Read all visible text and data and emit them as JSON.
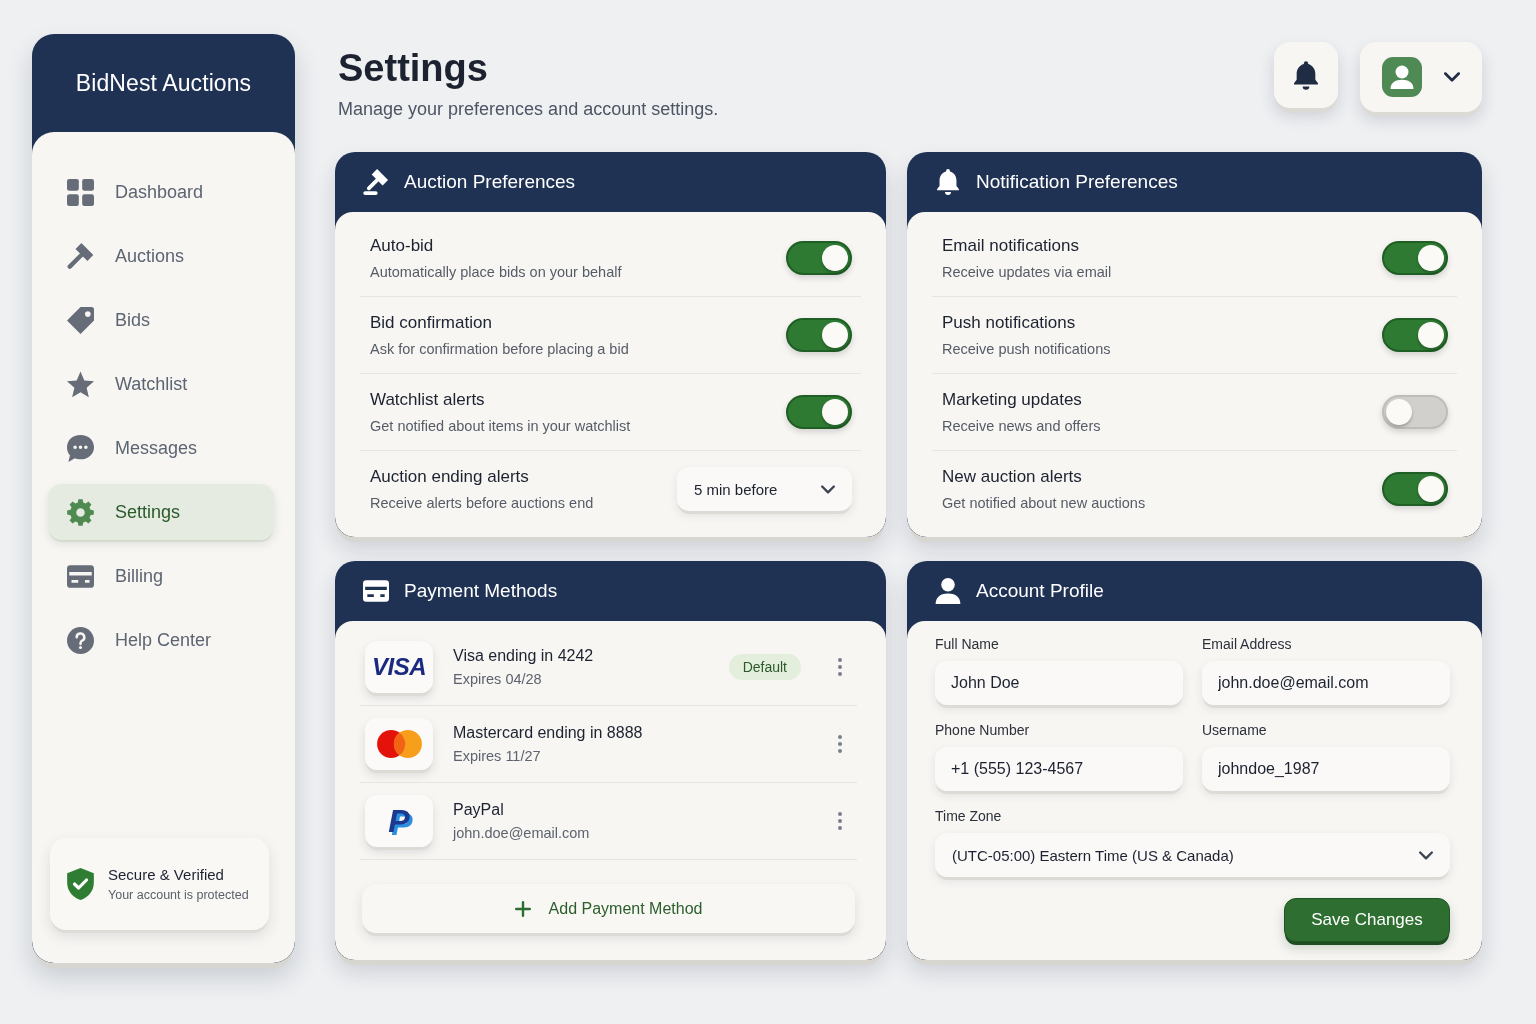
{
  "sidebar": {
    "brand": "BidNest Auctions",
    "items": [
      {
        "label": "Dashboard",
        "selected": false
      },
      {
        "label": "Auctions",
        "selected": false
      },
      {
        "label": "Bids",
        "selected": false
      },
      {
        "label": "Watchlist",
        "selected": false
      },
      {
        "label": "Messages",
        "selected": false
      },
      {
        "label": "Settings",
        "selected": true
      },
      {
        "label": "Billing",
        "selected": false
      },
      {
        "label": "Help Center",
        "selected": false
      }
    ],
    "security": {
      "title": "Secure & Verified",
      "subtitle": "Your account is protected"
    }
  },
  "header": {
    "title": "Settings",
    "subtitle": "Manage your preferences and account settings."
  },
  "auction_preferences": {
    "title": "Auction Preferences",
    "settings": [
      {
        "kind": "toggle",
        "label": "Auto-bid",
        "description": "Automatically place bids on your behalf",
        "on": true
      },
      {
        "kind": "toggle",
        "label": "Bid confirmation",
        "description": "Ask for confirmation before placing a bid",
        "on": true
      },
      {
        "kind": "toggle",
        "label": "Watchlist alerts",
        "description": "Get notified about items in your watchlist",
        "on": true
      },
      {
        "kind": "select",
        "label": "Auction ending alerts",
        "description": "Receive alerts before auctions end",
        "value": "5 min before"
      }
    ]
  },
  "notification_preferences": {
    "title": "Notification Preferences",
    "settings": [
      {
        "kind": "toggle",
        "label": "Email notifications",
        "description": "Receive updates via email",
        "on": true
      },
      {
        "kind": "toggle",
        "label": "Push notifications",
        "description": "Receive push notifications",
        "on": true
      },
      {
        "kind": "toggle",
        "label": "Marketing updates",
        "description": "Receive news and offers",
        "on": false
      },
      {
        "kind": "toggle",
        "label": "New auction alerts",
        "description": "Get notified about new auctions",
        "on": true
      }
    ]
  },
  "payment_methods": {
    "title": "Payment Methods",
    "methods": [
      {
        "kind": "visa",
        "logo_text": "VISA",
        "name": "Visa ending in 4242",
        "detail": "Expires 04/28",
        "badge": "Default"
      },
      {
        "kind": "mastercard",
        "name": "Mastercard ending in 8888",
        "detail": "Expires 11/27"
      },
      {
        "kind": "paypal",
        "logo_text": "P",
        "name": "PayPal",
        "detail": "john.doe@email.com"
      }
    ],
    "add_button": "Add Payment Method"
  },
  "account_profile": {
    "title": "Account Profile",
    "fields": [
      {
        "kind": "text",
        "label": "Full Name",
        "value": "John Doe"
      },
      {
        "kind": "text",
        "label": "Email Address",
        "value": "john.doe@email.com"
      },
      {
        "kind": "text",
        "label": "Phone Number",
        "value": "+1 (555) 123-4567"
      },
      {
        "kind": "text",
        "label": "Username",
        "value": "johndoe_1987"
      },
      {
        "kind": "select",
        "label": "Time Zone",
        "value": "(UTC-05:00) Eastern Time (US & Canada)"
      }
    ],
    "save_button": "Save Changes"
  }
}
